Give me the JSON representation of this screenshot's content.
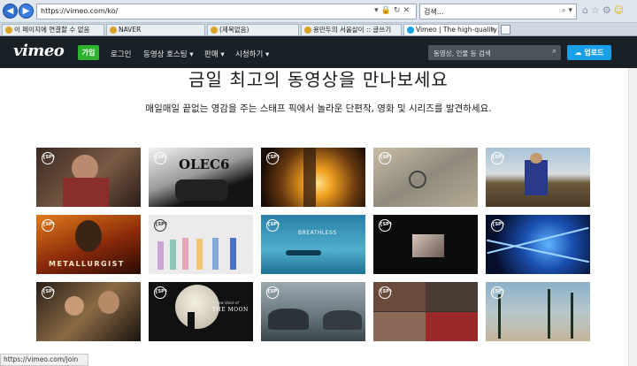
{
  "browser": {
    "url": "https://vimeo.com/ko/",
    "search_value": "검색...",
    "tabs": [
      {
        "label": "이 페이지에 연결할 수 없음"
      },
      {
        "label": "NAVER"
      },
      {
        "label": "(제목없음)"
      },
      {
        "label": "용만두의 서울살이 :: 글쓰기"
      },
      {
        "label": "Vimeo | The high-quality h..."
      }
    ],
    "status_url": "https://vimeo.com/join"
  },
  "header": {
    "logo": "vimeo",
    "join_label": "가입",
    "nav": [
      "로그인",
      "동영상 호스팅",
      "판매",
      "시청하기"
    ],
    "search_placeholder": "동영상, 인물 등 검색",
    "upload_label": "업로드"
  },
  "main": {
    "title": "금일 최고의 동영상을 만나보세요",
    "subtitle": "매일매일 끝없는 영감을 주는 스태프 픽에서 놀라운 단편작, 영화 및 시리즈를 발견하세요.",
    "badge": "{SP}",
    "thumbnail_texts": [
      "OLEC6",
      "METALLURGIST",
      "BREATHLESS",
      "THE MOON",
      "A New Voice of"
    ]
  }
}
